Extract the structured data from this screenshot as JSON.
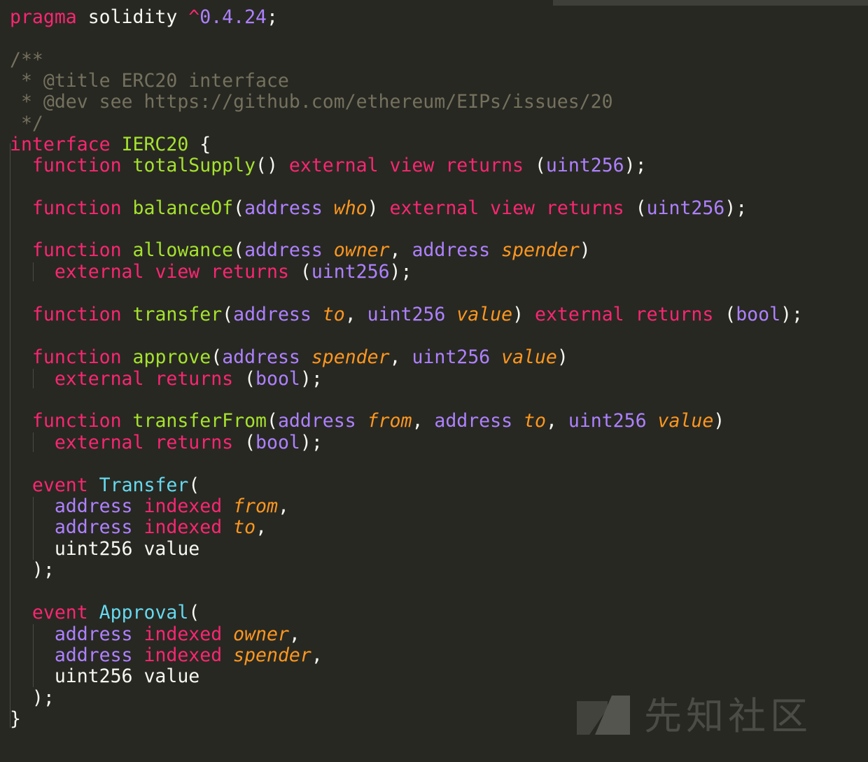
{
  "code": {
    "lines": [
      [
        [
          "key",
          "pragma"
        ],
        [
          "plain",
          " solidity "
        ],
        [
          "key",
          "^"
        ],
        [
          "num",
          "0.4.24"
        ],
        [
          "plain",
          ";"
        ]
      ],
      [],
      [
        [
          "comment",
          "/**"
        ]
      ],
      [
        [
          "comment",
          " * @title ERC20 interface"
        ]
      ],
      [
        [
          "comment",
          " * @dev see https://github.com/ethereum/EIPs/issues/20"
        ]
      ],
      [
        [
          "comment",
          " */"
        ]
      ],
      [
        [
          "key",
          "interface"
        ],
        [
          "plain",
          " "
        ],
        [
          "fn",
          "IERC20"
        ],
        [
          "plain",
          " {"
        ]
      ],
      [
        [
          "plain",
          "  "
        ],
        [
          "key",
          "function"
        ],
        [
          "plain",
          " "
        ],
        [
          "fn",
          "totalSupply"
        ],
        [
          "plain",
          "() "
        ],
        [
          "key",
          "external"
        ],
        [
          "plain",
          " "
        ],
        [
          "key",
          "view"
        ],
        [
          "plain",
          " "
        ],
        [
          "key",
          "returns"
        ],
        [
          "plain",
          " ("
        ],
        [
          "type",
          "uint256"
        ],
        [
          "plain",
          ");"
        ]
      ],
      [],
      [
        [
          "plain",
          "  "
        ],
        [
          "key",
          "function"
        ],
        [
          "plain",
          " "
        ],
        [
          "fn",
          "balanceOf"
        ],
        [
          "plain",
          "("
        ],
        [
          "type",
          "address"
        ],
        [
          "plain",
          " "
        ],
        [
          "param",
          "who"
        ],
        [
          "plain",
          ") "
        ],
        [
          "key",
          "external"
        ],
        [
          "plain",
          " "
        ],
        [
          "key",
          "view"
        ],
        [
          "plain",
          " "
        ],
        [
          "key",
          "returns"
        ],
        [
          "plain",
          " ("
        ],
        [
          "type",
          "uint256"
        ],
        [
          "plain",
          ");"
        ]
      ],
      [],
      [
        [
          "plain",
          "  "
        ],
        [
          "key",
          "function"
        ],
        [
          "plain",
          " "
        ],
        [
          "fn",
          "allowance"
        ],
        [
          "plain",
          "("
        ],
        [
          "type",
          "address"
        ],
        [
          "plain",
          " "
        ],
        [
          "param",
          "owner"
        ],
        [
          "plain",
          ", "
        ],
        [
          "type",
          "address"
        ],
        [
          "plain",
          " "
        ],
        [
          "param",
          "spender"
        ],
        [
          "plain",
          ")"
        ]
      ],
      [
        [
          "plain",
          "    "
        ],
        [
          "key",
          "external"
        ],
        [
          "plain",
          " "
        ],
        [
          "key",
          "view"
        ],
        [
          "plain",
          " "
        ],
        [
          "key",
          "returns"
        ],
        [
          "plain",
          " ("
        ],
        [
          "type",
          "uint256"
        ],
        [
          "plain",
          ");"
        ]
      ],
      [],
      [
        [
          "plain",
          "  "
        ],
        [
          "key",
          "function"
        ],
        [
          "plain",
          " "
        ],
        [
          "fn",
          "transfer"
        ],
        [
          "plain",
          "("
        ],
        [
          "type",
          "address"
        ],
        [
          "plain",
          " "
        ],
        [
          "param",
          "to"
        ],
        [
          "plain",
          ", "
        ],
        [
          "type",
          "uint256"
        ],
        [
          "plain",
          " "
        ],
        [
          "param",
          "value"
        ],
        [
          "plain",
          ") "
        ],
        [
          "key",
          "external"
        ],
        [
          "plain",
          " "
        ],
        [
          "key",
          "returns"
        ],
        [
          "plain",
          " ("
        ],
        [
          "type",
          "bool"
        ],
        [
          "plain",
          ");"
        ]
      ],
      [],
      [
        [
          "plain",
          "  "
        ],
        [
          "key",
          "function"
        ],
        [
          "plain",
          " "
        ],
        [
          "fn",
          "approve"
        ],
        [
          "plain",
          "("
        ],
        [
          "type",
          "address"
        ],
        [
          "plain",
          " "
        ],
        [
          "param",
          "spender"
        ],
        [
          "plain",
          ", "
        ],
        [
          "type",
          "uint256"
        ],
        [
          "plain",
          " "
        ],
        [
          "param",
          "value"
        ],
        [
          "plain",
          ")"
        ]
      ],
      [
        [
          "plain",
          "    "
        ],
        [
          "key",
          "external"
        ],
        [
          "plain",
          " "
        ],
        [
          "key",
          "returns"
        ],
        [
          "plain",
          " ("
        ],
        [
          "type",
          "bool"
        ],
        [
          "plain",
          ");"
        ]
      ],
      [],
      [
        [
          "plain",
          "  "
        ],
        [
          "key",
          "function"
        ],
        [
          "plain",
          " "
        ],
        [
          "fn",
          "transferFrom"
        ],
        [
          "plain",
          "("
        ],
        [
          "type",
          "address"
        ],
        [
          "plain",
          " "
        ],
        [
          "param",
          "from"
        ],
        [
          "plain",
          ", "
        ],
        [
          "type",
          "address"
        ],
        [
          "plain",
          " "
        ],
        [
          "param",
          "to"
        ],
        [
          "plain",
          ", "
        ],
        [
          "type",
          "uint256"
        ],
        [
          "plain",
          " "
        ],
        [
          "param",
          "value"
        ],
        [
          "plain",
          ")"
        ]
      ],
      [
        [
          "plain",
          "    "
        ],
        [
          "key",
          "external"
        ],
        [
          "plain",
          " "
        ],
        [
          "key",
          "returns"
        ],
        [
          "plain",
          " ("
        ],
        [
          "type",
          "bool"
        ],
        [
          "plain",
          ");"
        ]
      ],
      [],
      [
        [
          "plain",
          "  "
        ],
        [
          "key",
          "event"
        ],
        [
          "plain",
          " "
        ],
        [
          "cls",
          "Transfer"
        ],
        [
          "plain",
          "("
        ]
      ],
      [
        [
          "plain",
          "    "
        ],
        [
          "type",
          "address"
        ],
        [
          "plain",
          " "
        ],
        [
          "key",
          "indexed"
        ],
        [
          "plain",
          " "
        ],
        [
          "param",
          "from"
        ],
        [
          "plain",
          ","
        ]
      ],
      [
        [
          "plain",
          "    "
        ],
        [
          "type",
          "address"
        ],
        [
          "plain",
          " "
        ],
        [
          "key",
          "indexed"
        ],
        [
          "plain",
          " "
        ],
        [
          "param",
          "to"
        ],
        [
          "plain",
          ","
        ]
      ],
      [
        [
          "plain",
          "    uint256 value"
        ]
      ],
      [
        [
          "plain",
          "  );"
        ]
      ],
      [],
      [
        [
          "plain",
          "  "
        ],
        [
          "key",
          "event"
        ],
        [
          "plain",
          " "
        ],
        [
          "cls",
          "Approval"
        ],
        [
          "plain",
          "("
        ]
      ],
      [
        [
          "plain",
          "    "
        ],
        [
          "type",
          "address"
        ],
        [
          "plain",
          " "
        ],
        [
          "key",
          "indexed"
        ],
        [
          "plain",
          " "
        ],
        [
          "param",
          "owner"
        ],
        [
          "plain",
          ","
        ]
      ],
      [
        [
          "plain",
          "    "
        ],
        [
          "type",
          "address"
        ],
        [
          "plain",
          " "
        ],
        [
          "key",
          "indexed"
        ],
        [
          "plain",
          " "
        ],
        [
          "param",
          "spender"
        ],
        [
          "plain",
          ","
        ]
      ],
      [
        [
          "plain",
          "    uint256 value"
        ]
      ],
      [
        [
          "plain",
          "  );"
        ]
      ],
      [
        [
          "plain",
          "}"
        ]
      ]
    ]
  },
  "watermark": {
    "text": "先知社区"
  },
  "colors": {
    "background": "#272822",
    "keyword": "#f92672",
    "type": "#ae81ff",
    "function": "#a6e22e",
    "parameter": "#fd971f",
    "class": "#66d9ef",
    "comment": "#75715e",
    "plain": "#f8f8f2"
  }
}
